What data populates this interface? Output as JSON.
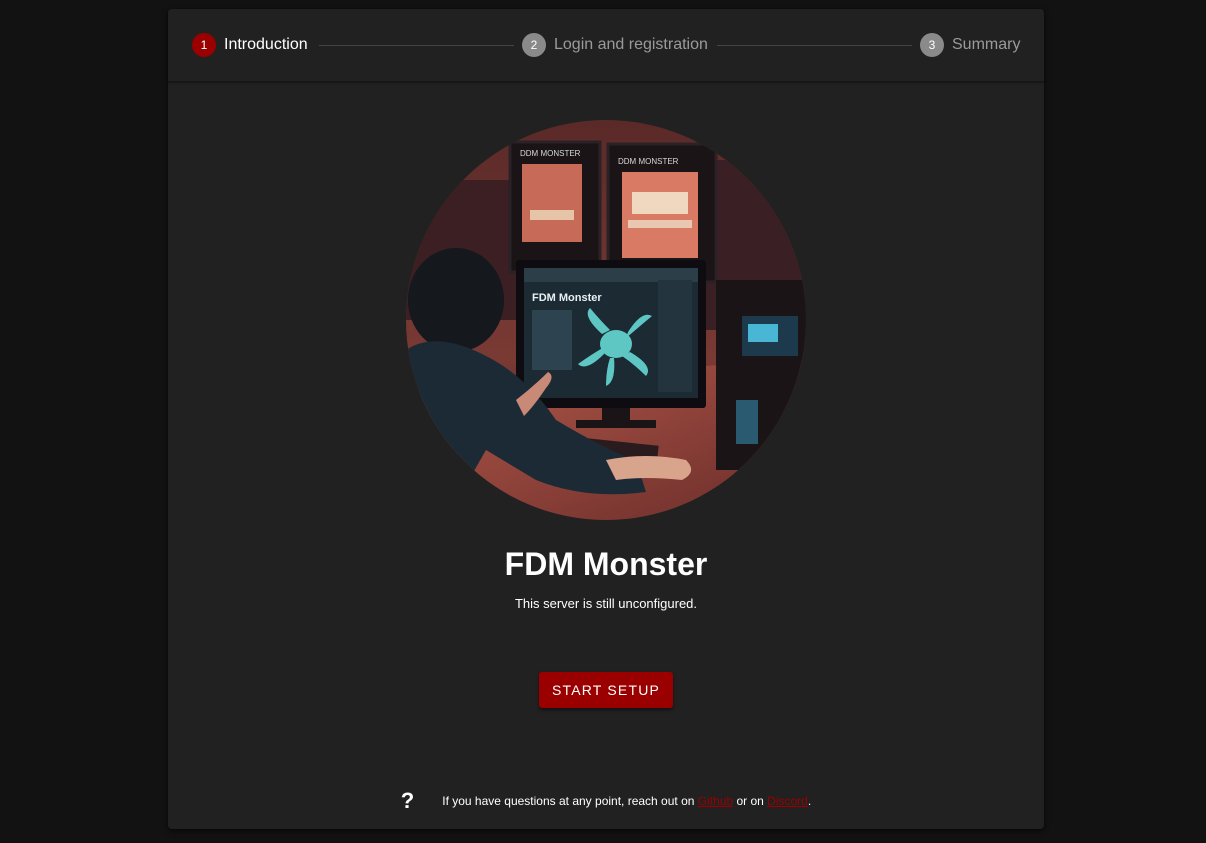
{
  "stepper": {
    "steps": [
      {
        "number": "1",
        "label": "Introduction",
        "active": true
      },
      {
        "number": "2",
        "label": "Login and registration",
        "active": false
      },
      {
        "number": "3",
        "label": "Summary",
        "active": false
      }
    ]
  },
  "hero": {
    "screen_title": "FDM Monster",
    "printer_brand_1": "DDM MONSTER",
    "printer_brand_2": "DDM MONSTER"
  },
  "main": {
    "title": "FDM Monster",
    "subtitle": "This server is still unconfigured.",
    "start_button": "START SETUP"
  },
  "help": {
    "icon": "question-icon",
    "text_before": "If you have questions at any point, reach out on",
    "github_link": "Github",
    "text_middle": "or on",
    "discord_link": "Discord",
    "text_after": "."
  },
  "colors": {
    "accent": "#9b0000",
    "background": "#121212",
    "card": "#212121"
  }
}
